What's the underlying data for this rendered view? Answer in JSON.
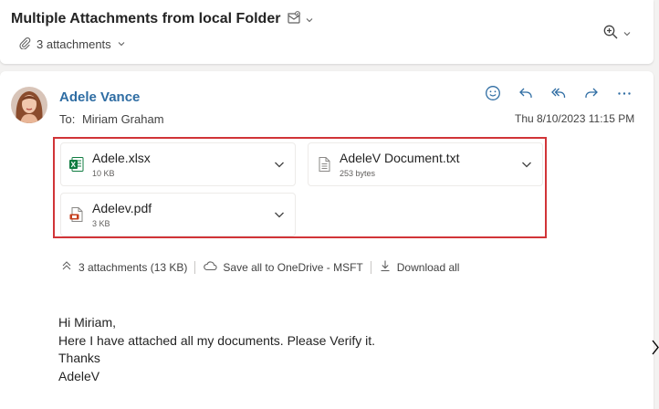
{
  "header": {
    "subject": "Multiple Attachments from local Folder",
    "attachments_summary": "3 attachments"
  },
  "message": {
    "sender": "Adele Vance",
    "to_label": "To:",
    "to_name": "Miriam Graham",
    "date": "Thu 8/10/2023 11:15 PM"
  },
  "attachments": [
    {
      "name": "Adele.xlsx",
      "size": "10 KB",
      "type": "excel-icon"
    },
    {
      "name": "AdeleV Document.txt",
      "size": "253 bytes",
      "type": "text-file-icon"
    },
    {
      "name": "Adelev.pdf",
      "size": "3 KB",
      "type": "pdf-icon"
    }
  ],
  "attachment_bar": {
    "count_label": "3 attachments (13 KB)",
    "save_label": "Save all to OneDrive - MSFT",
    "download_label": "Download all"
  },
  "body": {
    "lines": [
      "Hi Miriam,",
      "Here I have attached all my documents. Please Verify it.",
      "Thanks",
      "AdeleV"
    ]
  },
  "colors": {
    "accent": "#2f6da3",
    "highlight_border": "#d13438",
    "excel": "#107c41",
    "pdf": "#c43e1c"
  }
}
